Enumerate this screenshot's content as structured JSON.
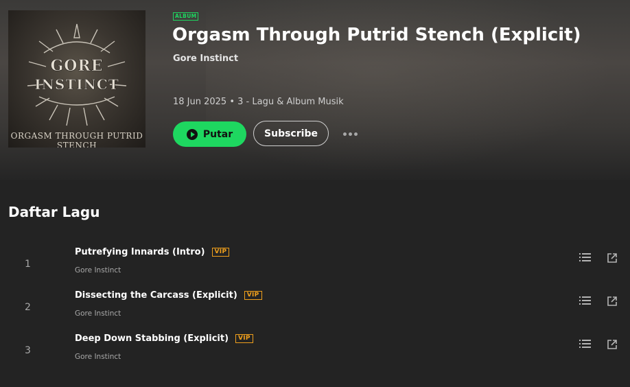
{
  "album": {
    "badge": "ALBUM",
    "title": "Orgasm Through Putrid Stench (Explicit)",
    "artist": "Gore Instinct",
    "meta": "18 Jun 2025 • 3 - Lagu & Album Musik",
    "cover_caption": "ORGASM THROUGH PUTRID STENCH",
    "cover_logo_text": "GORE INSTINCT"
  },
  "actions": {
    "play_label": "Putar",
    "subscribe_label": "Subscribe",
    "more_icon": "ellipsis-icon"
  },
  "tracklist": {
    "heading": "Daftar Lagu",
    "vip_label": "VIP",
    "tracks": [
      {
        "number": "1",
        "title": "Putrefying Innards (Intro)",
        "artist": "Gore Instinct"
      },
      {
        "number": "2",
        "title": "Dissecting the Carcass (Explicit)",
        "artist": "Gore Instinct"
      },
      {
        "number": "3",
        "title": "Deep Down Stabbing (Explicit)",
        "artist": "Gore Instinct"
      }
    ]
  },
  "colors": {
    "accent": "#1ed760",
    "vip": "#f0a01c",
    "background": "#232323"
  }
}
